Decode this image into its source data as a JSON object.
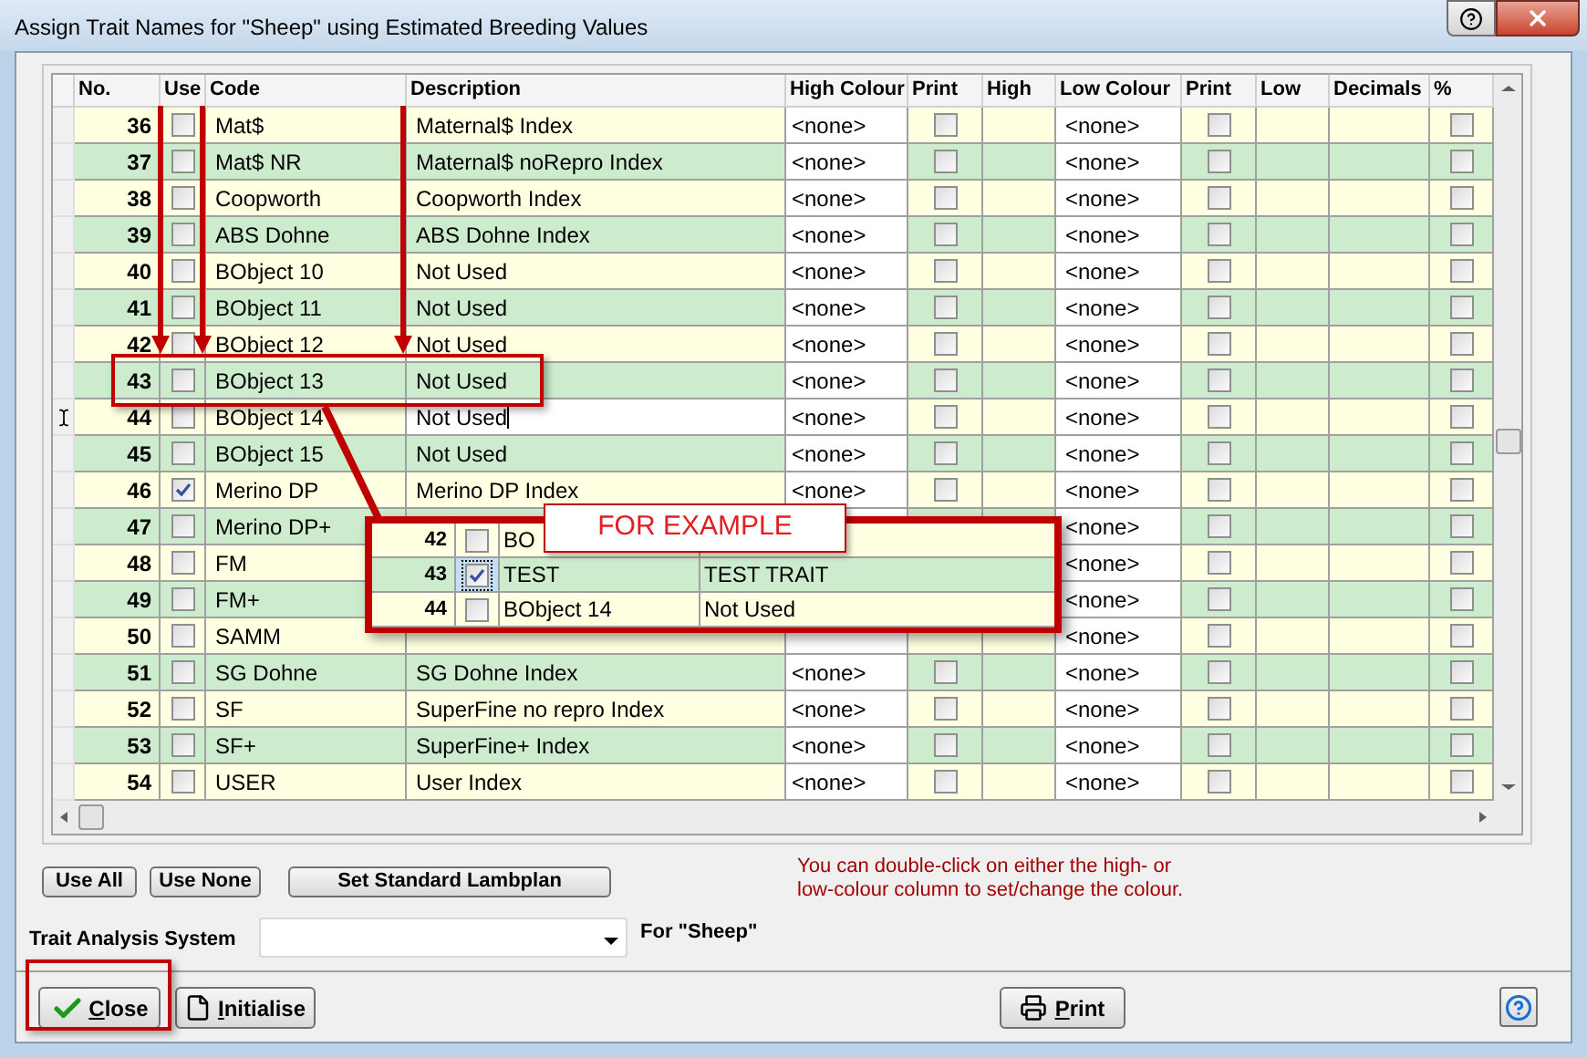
{
  "window": {
    "title": "Assign Trait Names for \"Sheep\" using Estimated Breeding Values"
  },
  "table": {
    "columns": [
      "No.",
      "Use",
      "Code",
      "Description",
      "High Colour",
      "Print",
      "High",
      "Low Colour",
      "Print",
      "Low",
      "Decimals",
      "%"
    ],
    "rows": [
      {
        "no": "36",
        "use": false,
        "code": "Mat$",
        "description": "Maternal$ Index",
        "high_colour": "<none>",
        "high_print": false,
        "low_colour": "<none>",
        "low_print": false,
        "percent": false,
        "editing": false
      },
      {
        "no": "37",
        "use": false,
        "code": "Mat$ NR",
        "description": "Maternal$ noRepro Index",
        "high_colour": "<none>",
        "high_print": false,
        "low_colour": "<none>",
        "low_print": false,
        "percent": false,
        "editing": false
      },
      {
        "no": "38",
        "use": false,
        "code": "Coopworth",
        "description": "Coopworth Index",
        "high_colour": "<none>",
        "high_print": false,
        "low_colour": "<none>",
        "low_print": false,
        "percent": false,
        "editing": false
      },
      {
        "no": "39",
        "use": false,
        "code": "ABS Dohne",
        "description": "ABS Dohne Index",
        "high_colour": "<none>",
        "high_print": false,
        "low_colour": "<none>",
        "low_print": false,
        "percent": false,
        "editing": false
      },
      {
        "no": "40",
        "use": false,
        "code": "BObject 10",
        "description": "Not Used",
        "high_colour": "<none>",
        "high_print": false,
        "low_colour": "<none>",
        "low_print": false,
        "percent": false,
        "editing": false
      },
      {
        "no": "41",
        "use": false,
        "code": "BObject 11",
        "description": "Not Used",
        "high_colour": "<none>",
        "high_print": false,
        "low_colour": "<none>",
        "low_print": false,
        "percent": false,
        "editing": false
      },
      {
        "no": "42",
        "use": false,
        "code": "BObject 12",
        "description": "Not Used",
        "high_colour": "<none>",
        "high_print": false,
        "low_colour": "<none>",
        "low_print": false,
        "percent": false,
        "editing": false
      },
      {
        "no": "43",
        "use": false,
        "code": "BObject 13",
        "description": "Not Used",
        "high_colour": "<none>",
        "high_print": false,
        "low_colour": "<none>",
        "low_print": false,
        "percent": false,
        "editing": false
      },
      {
        "no": "44",
        "use": false,
        "code": "BObject 14",
        "description": "Not Used",
        "high_colour": "<none>",
        "high_print": false,
        "low_colour": "<none>",
        "low_print": false,
        "percent": false,
        "editing": true
      },
      {
        "no": "45",
        "use": false,
        "code": "BObject 15",
        "description": "Not Used",
        "high_colour": "<none>",
        "high_print": false,
        "low_colour": "<none>",
        "low_print": false,
        "percent": false,
        "editing": false
      },
      {
        "no": "46",
        "use": true,
        "code": "Merino DP",
        "description": "Merino DP Index",
        "high_colour": "<none>",
        "high_print": false,
        "low_colour": "<none>",
        "low_print": false,
        "percent": false,
        "editing": false
      },
      {
        "no": "47",
        "use": false,
        "code": "Merino DP+",
        "low_colour": "<none>",
        "low_print": false,
        "percent": false,
        "editing": false
      },
      {
        "no": "48",
        "use": false,
        "code": "FM",
        "low_colour": "<none>",
        "low_print": false,
        "percent": false,
        "editing": false
      },
      {
        "no": "49",
        "use": false,
        "code": "FM+",
        "low_colour": "<none>",
        "low_print": false,
        "percent": false,
        "editing": false
      },
      {
        "no": "50",
        "use": false,
        "code": "SAMM",
        "low_colour": "<none>",
        "low_print": false,
        "percent": false,
        "editing": false
      },
      {
        "no": "51",
        "use": false,
        "code": "SG Dohne",
        "description": "SG Dohne Index",
        "high_colour": "<none>",
        "high_print": false,
        "low_colour": "<none>",
        "low_print": false,
        "percent": false,
        "editing": false
      },
      {
        "no": "52",
        "use": false,
        "code": "SF",
        "description": "SuperFine no repro Index",
        "high_colour": "<none>",
        "high_print": false,
        "low_colour": "<none>",
        "low_print": false,
        "percent": false,
        "editing": false
      },
      {
        "no": "53",
        "use": false,
        "code": "SF+",
        "description": "SuperFine+ Index",
        "high_colour": "<none>",
        "high_print": false,
        "low_colour": "<none>",
        "low_print": false,
        "percent": false,
        "editing": false
      },
      {
        "no": "54",
        "use": false,
        "code": "USER",
        "description": "User Index",
        "high_colour": "<none>",
        "high_print": false,
        "low_colour": "<none>",
        "low_print": false,
        "percent": false,
        "editing": false
      }
    ]
  },
  "buttons": [
    "Use All",
    "Use None",
    "Set Standard Lambplan"
  ],
  "hint": "You can double-click on either the high- or\nlow-colour column to set/change the colour.",
  "trait_system": {
    "label": "Trait Analysis System",
    "species": "For \"Sheep\""
  },
  "footer": {
    "close": "Close",
    "initialise": "Initialise",
    "print": "Print"
  },
  "annotation": {
    "callout": "FOR EXAMPLE",
    "rows": [
      {
        "no": "42",
        "use": false,
        "code": "BO",
        "selected": false
      },
      {
        "no": "43",
        "use": true,
        "code": "TEST",
        "description": "TEST TRAIT",
        "selected": true
      },
      {
        "no": "44",
        "use": false,
        "code": "BObject 14",
        "description": "Not Used",
        "selected": false
      }
    ]
  }
}
